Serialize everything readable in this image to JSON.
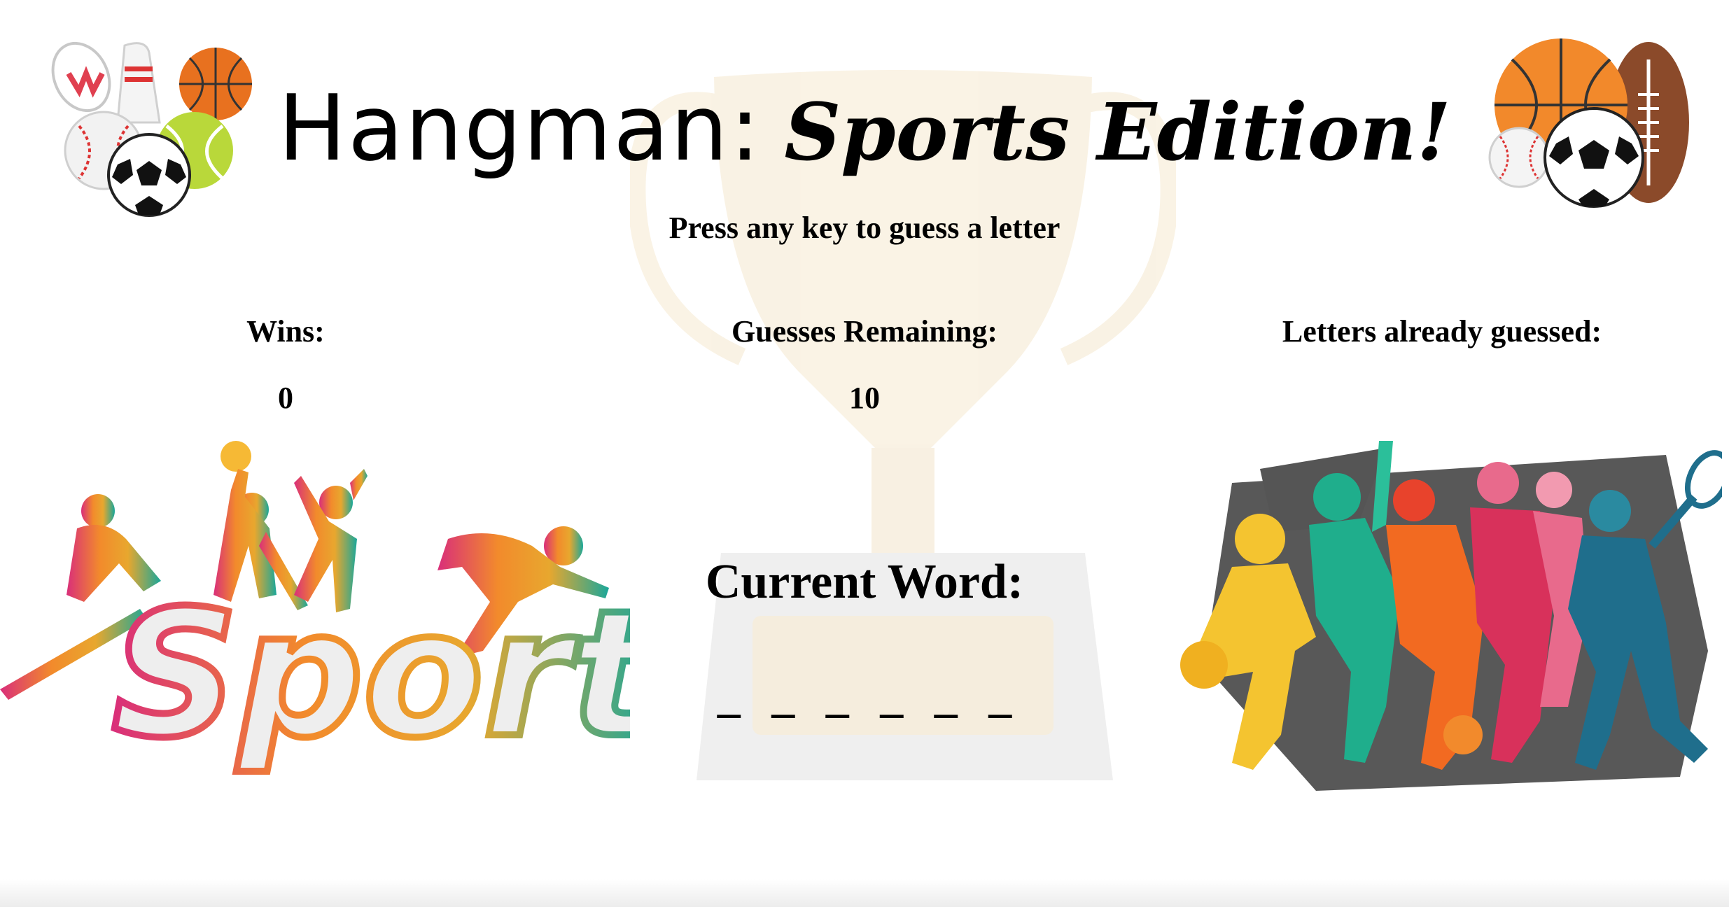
{
  "title": {
    "part1": "Hangman:",
    "part2": "Sports Edition!"
  },
  "instruction": "Press any key to guess a letter",
  "stats": {
    "wins": {
      "label": "Wins:",
      "value": "0"
    },
    "guesses": {
      "label": "Guesses Remaining:",
      "value": "10"
    },
    "letters": {
      "label": "Letters already guessed:",
      "value": ""
    }
  },
  "current": {
    "label": "Current Word:",
    "word": "_ _ _ _ _ _"
  },
  "images": {
    "logo_text": "Sport",
    "left": "sports-balls-cluster-left",
    "right": "sports-balls-cluster-right",
    "trophy": "trophy-watermark",
    "athletes": "colorful-athletes-silhouettes"
  }
}
